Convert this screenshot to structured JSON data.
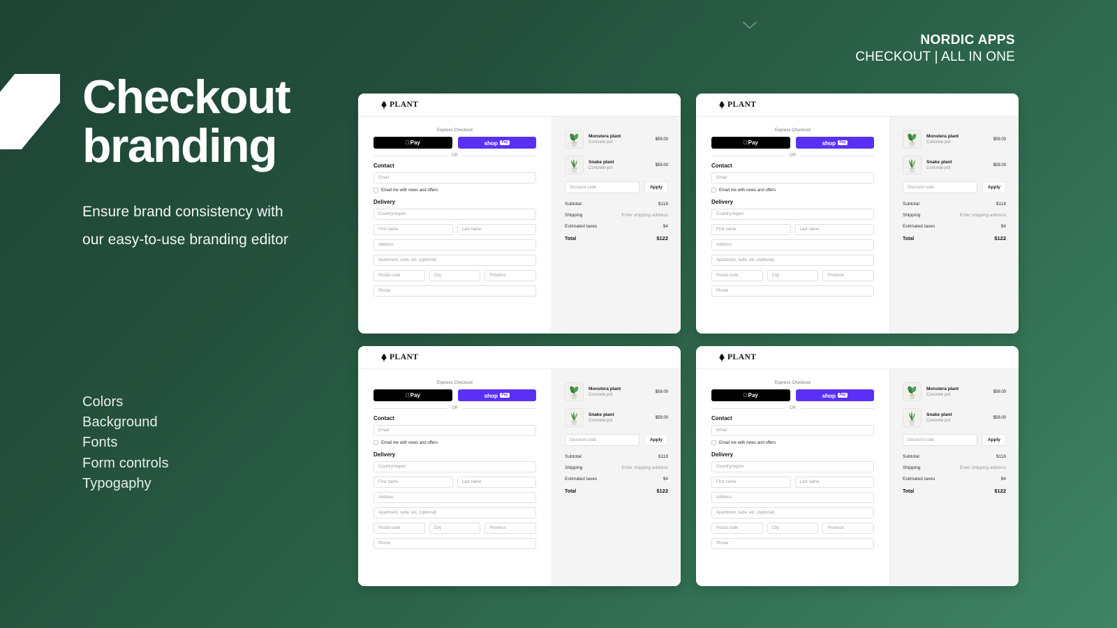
{
  "brand_header": {
    "line1": "NORDIC APPS",
    "line2": "CHECKOUT | ALL IN ONE"
  },
  "hero": {
    "headline": "Checkout\nbranding",
    "subtitle": "Ensure brand consistency with our easy-to-use branding editor"
  },
  "features": [
    "Colors",
    "Background",
    "Fonts",
    "Form controls",
    "Typogaphy"
  ],
  "colors": {
    "bg_dark": "#1e4334",
    "bg_light": "#3f8364",
    "shop_pay_purple": "#5a31f4",
    "apple_pay_black": "#000000",
    "card_white": "#ffffff",
    "summary_grey": "#f4f4f4"
  },
  "checkout": {
    "logo_text": "PLANT",
    "express_label": "Express Checkout",
    "apple_pay_label": "Pay",
    "shop_pay_word": "shop",
    "shop_pay_badge": "Pay",
    "or_label": "OR",
    "contact_title": "Contact",
    "email_placeholder": "Email",
    "newsletter_label": "Email me with news and offers",
    "delivery_title": "Delivery",
    "fields": {
      "country": "Country/region",
      "first_name": "First name",
      "last_name": "Last name",
      "address": "Address",
      "apartment": "Apartment, suite, etc. (optional)",
      "postal_code": "Postal code",
      "city": "City",
      "province": "Province",
      "phone": "Phone"
    },
    "summary": {
      "items": [
        {
          "name": "Monstera plant",
          "variant": "Concrete pot",
          "price": "$59.00"
        },
        {
          "name": "Snake plant",
          "variant": "Concrete pot",
          "price": "$59.00"
        }
      ],
      "discount_placeholder": "Discount code",
      "apply_label": "Apply",
      "rows": [
        {
          "label": "Subtotal",
          "value": "$118",
          "muted": false
        },
        {
          "label": "Shipping",
          "value": "Enter shipping address",
          "muted": true
        },
        {
          "label": "Estimated taxes",
          "value": "$4",
          "muted": false
        }
      ],
      "total_label": "Total",
      "total_value": "$122"
    }
  },
  "cards": [
    {
      "id": "card-top-left"
    },
    {
      "id": "card-top-right"
    },
    {
      "id": "card-bottom-left"
    },
    {
      "id": "card-bottom-right"
    }
  ]
}
